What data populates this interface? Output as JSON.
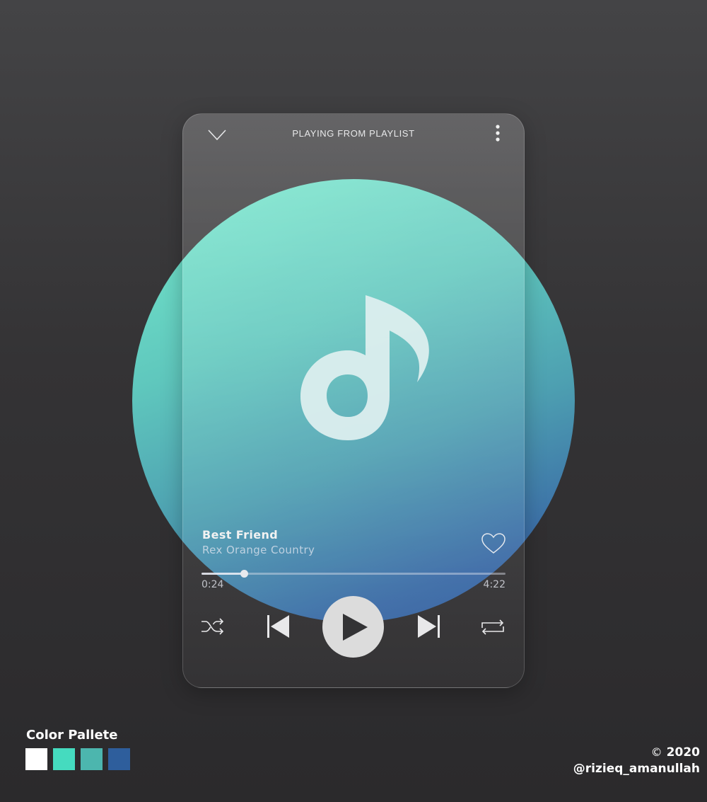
{
  "player": {
    "header_title": "PLAYING FROM PLAYLIST",
    "track_title": "Best Friend",
    "track_artist": "Rex Orange Country",
    "elapsed": "0:24",
    "total": "4:22",
    "progress_fraction": 0.14
  },
  "icons": {
    "collapse": "chevron-down-icon",
    "more": "more-vertical-icon",
    "artwork": "music-note-icon",
    "like": "heart-icon",
    "shuffle": "shuffle-icon",
    "previous": "skip-previous-icon",
    "play": "play-icon",
    "next": "skip-next-icon",
    "repeat": "repeat-icon"
  },
  "palette": {
    "title": "Color Pallete",
    "colors": [
      "#ffffff",
      "#45dbbf",
      "#4cb6ae",
      "#2e5e9c"
    ]
  },
  "credit": {
    "copyright_symbol": "©",
    "year": "2020",
    "handle": "@rizieq_amanullah"
  }
}
